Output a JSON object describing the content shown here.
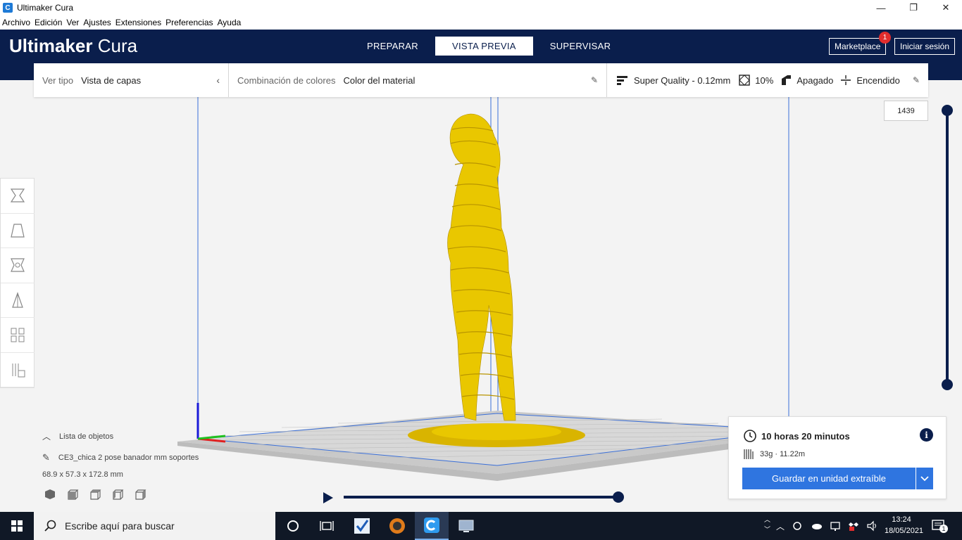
{
  "window": {
    "title": "Ultimaker Cura",
    "minimize": "—",
    "maximize": "❐",
    "close": "✕"
  },
  "menu": [
    "Archivo",
    "Edición",
    "Ver",
    "Ajustes",
    "Extensiones",
    "Preferencias",
    "Ayuda"
  ],
  "header": {
    "logo_bold": "Ultimaker",
    "logo_light": "Cura",
    "stages": [
      "PREPARAR",
      "VISTA PREVIA",
      "SUPERVISAR"
    ],
    "active_stage": "VISTA PREVIA",
    "marketplace": "Marketplace",
    "marketplace_badge": "1",
    "signin": "Iniciar sesión"
  },
  "settings": {
    "view_type_label": "Ver tipo",
    "view_type_value": "Vista de capas",
    "color_scheme_label": "Combinación de colores",
    "color_scheme_value": "Color del material",
    "profile": "Super Quality - 0.12mm",
    "infill": "10%",
    "support": "Apagado",
    "adhesion": "Encendido"
  },
  "layer_slider": {
    "current_layer": "1439"
  },
  "object_list": {
    "header": "Lista de objetos",
    "object_name": "CE3_chica 2 pose banador mm soportes",
    "dimensions": "68.9 x 57.3 x 172.8 mm"
  },
  "print_info": {
    "time": "10 horas 20 minutos",
    "material": "33g · 11.22m",
    "save_button": "Guardar en unidad extraíble"
  },
  "taskbar": {
    "search_placeholder": "Escribe aquí para buscar",
    "time": "13:24",
    "date": "18/05/2021",
    "notification_count": "1"
  },
  "colors": {
    "header_bg": "#0a1e4c",
    "model": "#e9c700",
    "accent_blue": "#2f75e0"
  }
}
